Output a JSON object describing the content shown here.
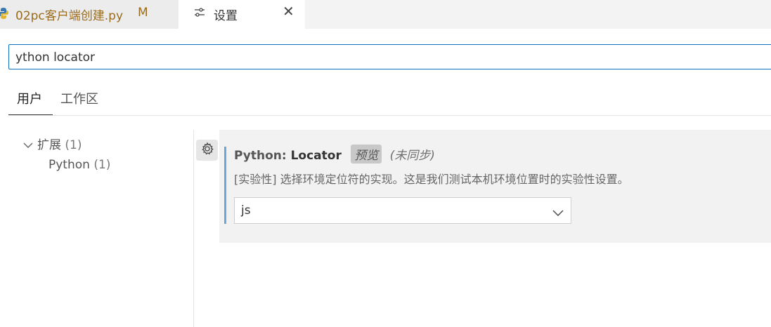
{
  "tabs": [
    {
      "label": "02pc客户端创建.py",
      "status": "M",
      "icon": "python-icon"
    },
    {
      "label": "设置",
      "icon": "settings-icon",
      "close": "✕"
    }
  ],
  "search": {
    "value": "ython locator"
  },
  "scopes": {
    "user": "用户",
    "workspace": "工作区"
  },
  "tree": {
    "extensions": {
      "label": "扩展",
      "count": "(1)"
    },
    "python": {
      "label": "Python",
      "count": "(1)"
    }
  },
  "setting": {
    "category": "Python: ",
    "key": "Locator",
    "badge": "预览",
    "sync": "(未同步)",
    "description": "[实验性] 选择环境定位符的实现。这是我们测试本机环境位置时的实验性设置。",
    "value": "js"
  },
  "colors": {
    "accent": "#0e70c0",
    "modified": "#9a6b1d",
    "setting_bar": "#6ea6d9"
  }
}
